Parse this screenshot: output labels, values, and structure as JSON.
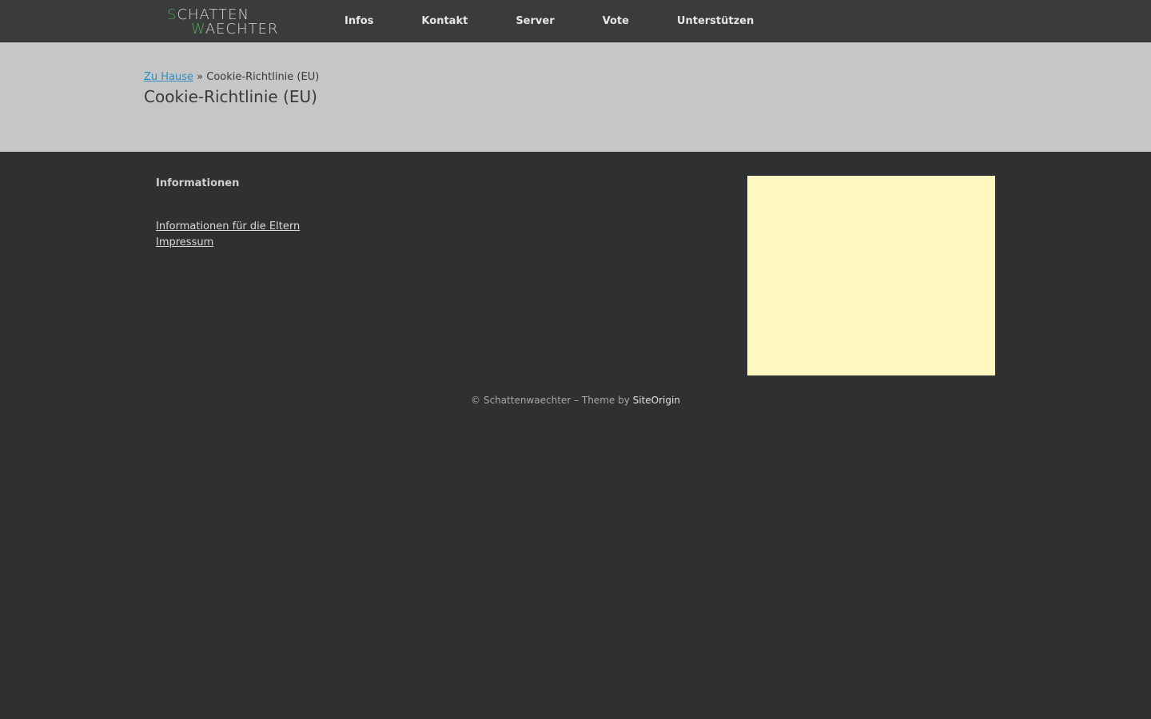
{
  "header": {
    "logo": {
      "line1": "SCHATTEN",
      "line2": "WAECHTER",
      "accent_color": "#4fa84f",
      "text_color": "#d8d8d8"
    },
    "nav": [
      {
        "label": "Infos"
      },
      {
        "label": "Kontakt"
      },
      {
        "label": "Server"
      },
      {
        "label": "Vote"
      },
      {
        "label": "Unterstützen"
      }
    ]
  },
  "banner": {
    "breadcrumb": {
      "home_label": "Zu Hause",
      "separator": "»",
      "current": "Cookie-Richtlinie (EU)"
    },
    "title": "Cookie-Richtlinie (EU)"
  },
  "footer_widgets": {
    "title": "Informationen",
    "links": [
      {
        "label": "Informationen für die Eltern"
      },
      {
        "label": "Impressum"
      }
    ],
    "ad_color": "#fef8c0"
  },
  "credit": {
    "copyright": "© Schattenwaechter",
    "dash": "–",
    "theme_by": "Theme by",
    "theme_link": "SiteOrigin"
  },
  "colors": {
    "background": "#2f3032",
    "topbar": "#3a3b3d",
    "banner": "#c6c6c6",
    "link_blue": "#2d8ec3"
  }
}
